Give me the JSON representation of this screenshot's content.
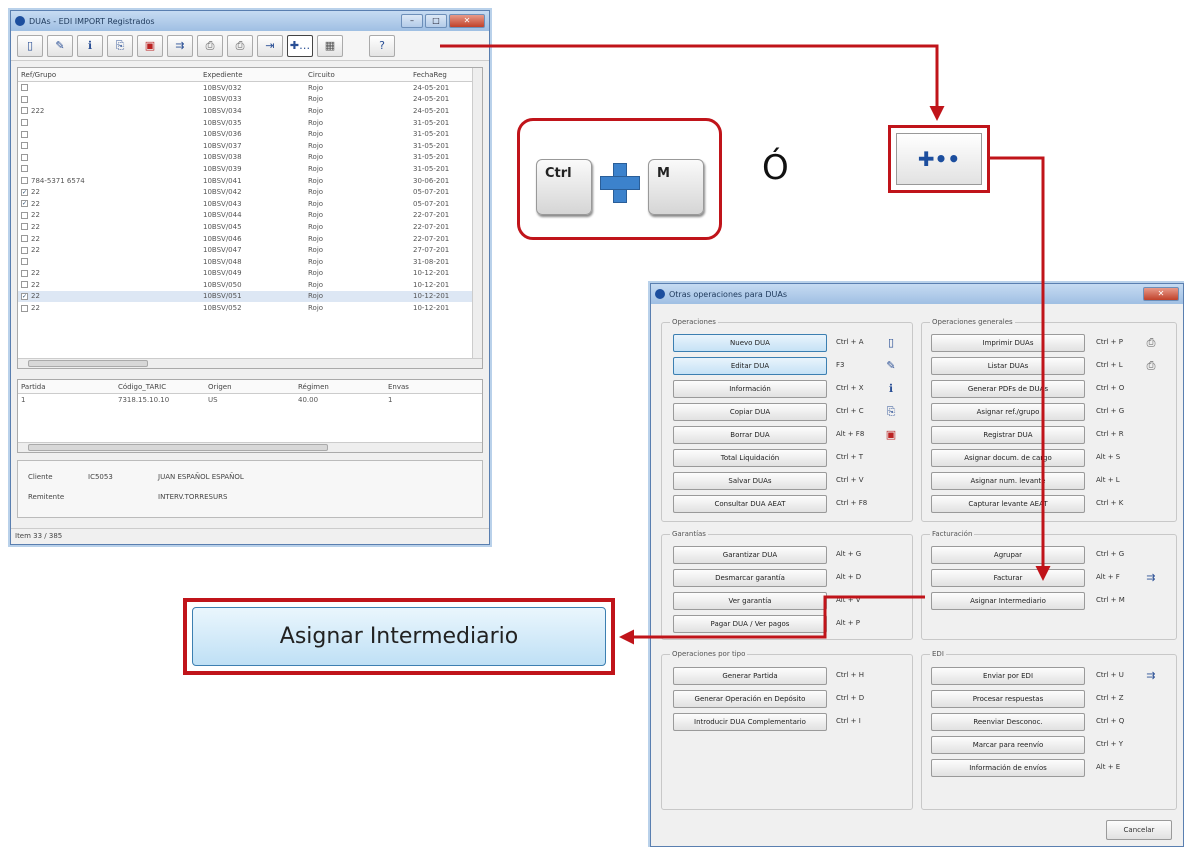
{
  "main_window": {
    "title": "DUAs - EDI IMPORT Registrados",
    "columns": [
      "Ref/Grupo",
      "Expediente",
      "Circuito",
      "FechaReg"
    ],
    "rows": [
      {
        "ref": "",
        "checked": false,
        "exp": "10BSV/032",
        "circ": "Rojo",
        "fecha": "24-05-201"
      },
      {
        "ref": "",
        "checked": false,
        "exp": "10BSV/033",
        "circ": "Rojo",
        "fecha": "24-05-201"
      },
      {
        "ref": "222",
        "checked": false,
        "exp": "10BSV/034",
        "circ": "Rojo",
        "fecha": "24-05-201"
      },
      {
        "ref": "",
        "checked": false,
        "exp": "10BSV/035",
        "circ": "Rojo",
        "fecha": "31-05-201"
      },
      {
        "ref": "",
        "checked": false,
        "exp": "10BSV/036",
        "circ": "Rojo",
        "fecha": "31-05-201"
      },
      {
        "ref": "",
        "checked": false,
        "exp": "10BSV/037",
        "circ": "Rojo",
        "fecha": "31-05-201"
      },
      {
        "ref": "",
        "checked": false,
        "exp": "10BSV/038",
        "circ": "Rojo",
        "fecha": "31-05-201"
      },
      {
        "ref": "",
        "checked": false,
        "exp": "10BSV/039",
        "circ": "Rojo",
        "fecha": "31-05-201"
      },
      {
        "ref": "784-5371 6574",
        "checked": false,
        "exp": "10BSV/041",
        "circ": "Rojo",
        "fecha": "30-06-201"
      },
      {
        "ref": "22",
        "checked": true,
        "exp": "10BSV/042",
        "circ": "Rojo",
        "fecha": "05-07-201"
      },
      {
        "ref": "22",
        "checked": true,
        "exp": "10BSV/043",
        "circ": "Rojo",
        "fecha": "05-07-201"
      },
      {
        "ref": "22",
        "checked": false,
        "exp": "10BSV/044",
        "circ": "Rojo",
        "fecha": "22-07-201"
      },
      {
        "ref": "22",
        "checked": false,
        "exp": "10BSV/045",
        "circ": "Rojo",
        "fecha": "22-07-201"
      },
      {
        "ref": "22",
        "checked": false,
        "exp": "10BSV/046",
        "circ": "Rojo",
        "fecha": "22-07-201"
      },
      {
        "ref": "22",
        "checked": false,
        "exp": "10BSV/047",
        "circ": "Rojo",
        "fecha": "27-07-201"
      },
      {
        "ref": "",
        "checked": false,
        "exp": "10BSV/048",
        "circ": "Rojo",
        "fecha": "31-08-201"
      },
      {
        "ref": "22",
        "checked": false,
        "exp": "10BSV/049",
        "circ": "Rojo",
        "fecha": "10-12-201"
      },
      {
        "ref": "22",
        "checked": false,
        "exp": "10BSV/050",
        "circ": "Rojo",
        "fecha": "10-12-201"
      },
      {
        "ref": "22",
        "checked": true,
        "exp": "10BSV/051",
        "circ": "Rojo",
        "fecha": "10-12-201",
        "selected": true
      },
      {
        "ref": "22",
        "checked": false,
        "exp": "10BSV/052",
        "circ": "Rojo",
        "fecha": "10-12-201"
      }
    ],
    "sub_columns": [
      "Partida",
      "Código_TARIC",
      "Origen",
      "Régimen",
      "Envas"
    ],
    "sub_row": [
      "1",
      "7318.15.10.10",
      "US",
      "40.00",
      "1"
    ],
    "cliente_label": "Cliente",
    "cliente_code": "IC5053",
    "cliente_name": "JUAN ESPAÑOL ESPAÑOL",
    "remitente_label": "Remitente",
    "remitente_name": "INTERV.TORRESURS",
    "status": "Item 33 / 385"
  },
  "shortcut": {
    "key1": "Ctrl",
    "key2": "M",
    "or_label": "Ó"
  },
  "dialog": {
    "title": "Otras operaciones para DUAs",
    "groups": {
      "operaciones": "Operaciones",
      "generales": "Operaciones generales",
      "garantias": "Garantías",
      "facturacion": "Facturación",
      "por_tipo": "Operaciones por tipo",
      "edi": "EDI"
    },
    "ops": [
      {
        "label": "Nuevo DUA",
        "sc": "Ctrl + A"
      },
      {
        "label": "Editar DUA",
        "sc": "F3"
      },
      {
        "label": "Información",
        "sc": "Ctrl + X"
      },
      {
        "label": "Copiar DUA",
        "sc": "Ctrl + C"
      },
      {
        "label": "Borrar DUA",
        "sc": "Alt + F8"
      },
      {
        "label": "Total Liquidación",
        "sc": "Ctrl + T"
      },
      {
        "label": "Salvar DUAs",
        "sc": "Ctrl + V"
      },
      {
        "label": "Consultar DUA AEAT",
        "sc": "Ctrl + F8"
      }
    ],
    "gen": [
      {
        "label": "Imprimir DUAs",
        "sc": "Ctrl + P"
      },
      {
        "label": "Listar DUAs",
        "sc": "Ctrl + L"
      },
      {
        "label": "Generar PDFs de DUAs",
        "sc": "Ctrl + O"
      },
      {
        "label": "Asignar ref./grupo",
        "sc": "Ctrl + G"
      },
      {
        "label": "Registrar DUA",
        "sc": "Ctrl + R"
      },
      {
        "label": "Asignar docum. de cargo",
        "sc": "Alt + S"
      },
      {
        "label": "Asignar num. levante",
        "sc": "Alt + L"
      },
      {
        "label": "Capturar levante AEAT",
        "sc": "Ctrl + K"
      }
    ],
    "gar": [
      {
        "label": "Garantizar DUA",
        "sc": "Alt + G"
      },
      {
        "label": "Desmarcar garantía",
        "sc": "Alt + D"
      },
      {
        "label": "Ver garantía",
        "sc": "Alt + V"
      },
      {
        "label": "Pagar DUA / Ver pagos",
        "sc": "Alt + P"
      }
    ],
    "fac": [
      {
        "label": "Agrupar",
        "sc": "Ctrl + G"
      },
      {
        "label": "Facturar",
        "sc": "Alt + F"
      },
      {
        "label": "Asignar Intermediario",
        "sc": "Ctrl + M"
      }
    ],
    "tipo": [
      {
        "label": "Generar Partida",
        "sc": "Ctrl + H"
      },
      {
        "label": "Generar Operación en Depósito",
        "sc": "Ctrl + D"
      },
      {
        "label": "Introducir DUA Complementario",
        "sc": "Ctrl + I"
      }
    ],
    "edi": [
      {
        "label": "Enviar por EDI",
        "sc": "Ctrl + U"
      },
      {
        "label": "Procesar respuestas",
        "sc": "Ctrl + Z"
      },
      {
        "label": "Reenviar Desconoc.",
        "sc": "Ctrl + Q"
      },
      {
        "label": "Marcar para reenvío",
        "sc": "Ctrl + Y"
      },
      {
        "label": "Información de envíos",
        "sc": "Alt + E"
      }
    ],
    "cancel": "Cancelar"
  },
  "callout_button": "Asignar Intermediario",
  "colors": {
    "highlight_red": "#c0141a",
    "button_blue": "#c6e2f6"
  }
}
